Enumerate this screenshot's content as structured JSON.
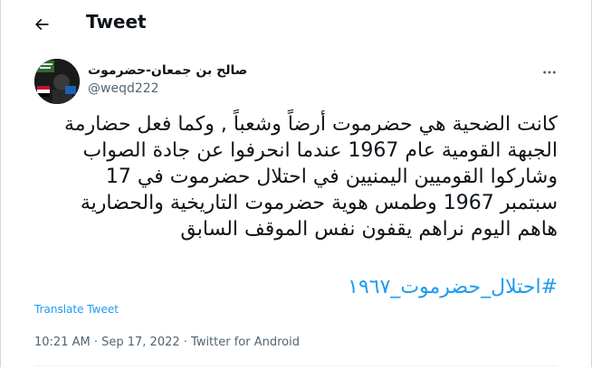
{
  "header": {
    "title": "Tweet",
    "back_icon": "arrow-left-icon"
  },
  "author": {
    "name": "صالح بن جمعان-حضرموت",
    "handle": "@weqd222"
  },
  "tweet": {
    "lines": [
      "كانت الضحية هي حضرموت أرضاً وشعباً , وكما فعل حضارمة",
      "الجبهة القومية عام 1967 عندما انحرفوا عن جادة الصواب",
      "وشاركوا القوميين اليمنيين في احتلال حضرموت في 17",
      "سبتمبر 1967 وطمس هوية حضرموت التاريخية والحضارية",
      "هاهم اليوم نراهم يقفون نفس الموقف السابق"
    ],
    "hashtag": "#احتلال_حضرموت_١٩٦٧",
    "translate_label": "Translate Tweet",
    "timestamp": "10:21 AM · Sep 17, 2022 · Twitter for Android"
  },
  "colors": {
    "link": "#1d9bf0",
    "secondary": "#536471",
    "text": "#0f1419"
  }
}
